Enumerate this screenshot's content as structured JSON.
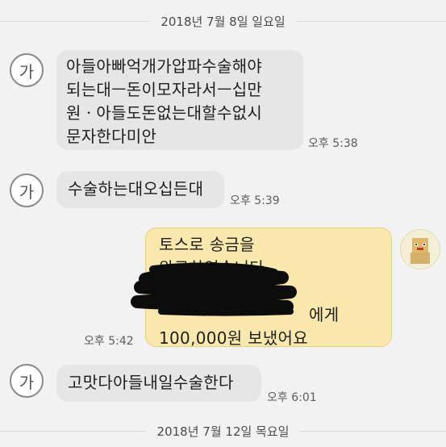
{
  "date_separators": {
    "top": "2018년 7월 8일 일요일",
    "bottom": "2018년 7월 12일 목요일"
  },
  "contact": {
    "avatar_char": "가"
  },
  "messages": [
    {
      "lines": [
        "아들아빠억개가압파수술해야",
        "되는대ㅡ돈이모자라서ㅡ십만",
        "원ㆍ아들도돈없는대할수없시",
        "문자한다미안"
      ],
      "time": "오후 5:38"
    },
    {
      "lines": [
        "수술하는대오십든대"
      ],
      "time": "오후 5:39"
    },
    {
      "lines": [
        "토스로 송금을",
        "완료하였습니다.",
        "",
        "에게",
        "100,000원 보냈어요"
      ],
      "time": "오후 5:42"
    },
    {
      "lines": [
        "고맛다아들내일수술한다"
      ],
      "time": "오후 6:01"
    }
  ],
  "colors": {
    "background": "#f2f2f2",
    "incoming_bubble": "#e6e6e6",
    "outgoing_bubble": "#fbe8ac",
    "redaction": "#0c0c0c"
  }
}
